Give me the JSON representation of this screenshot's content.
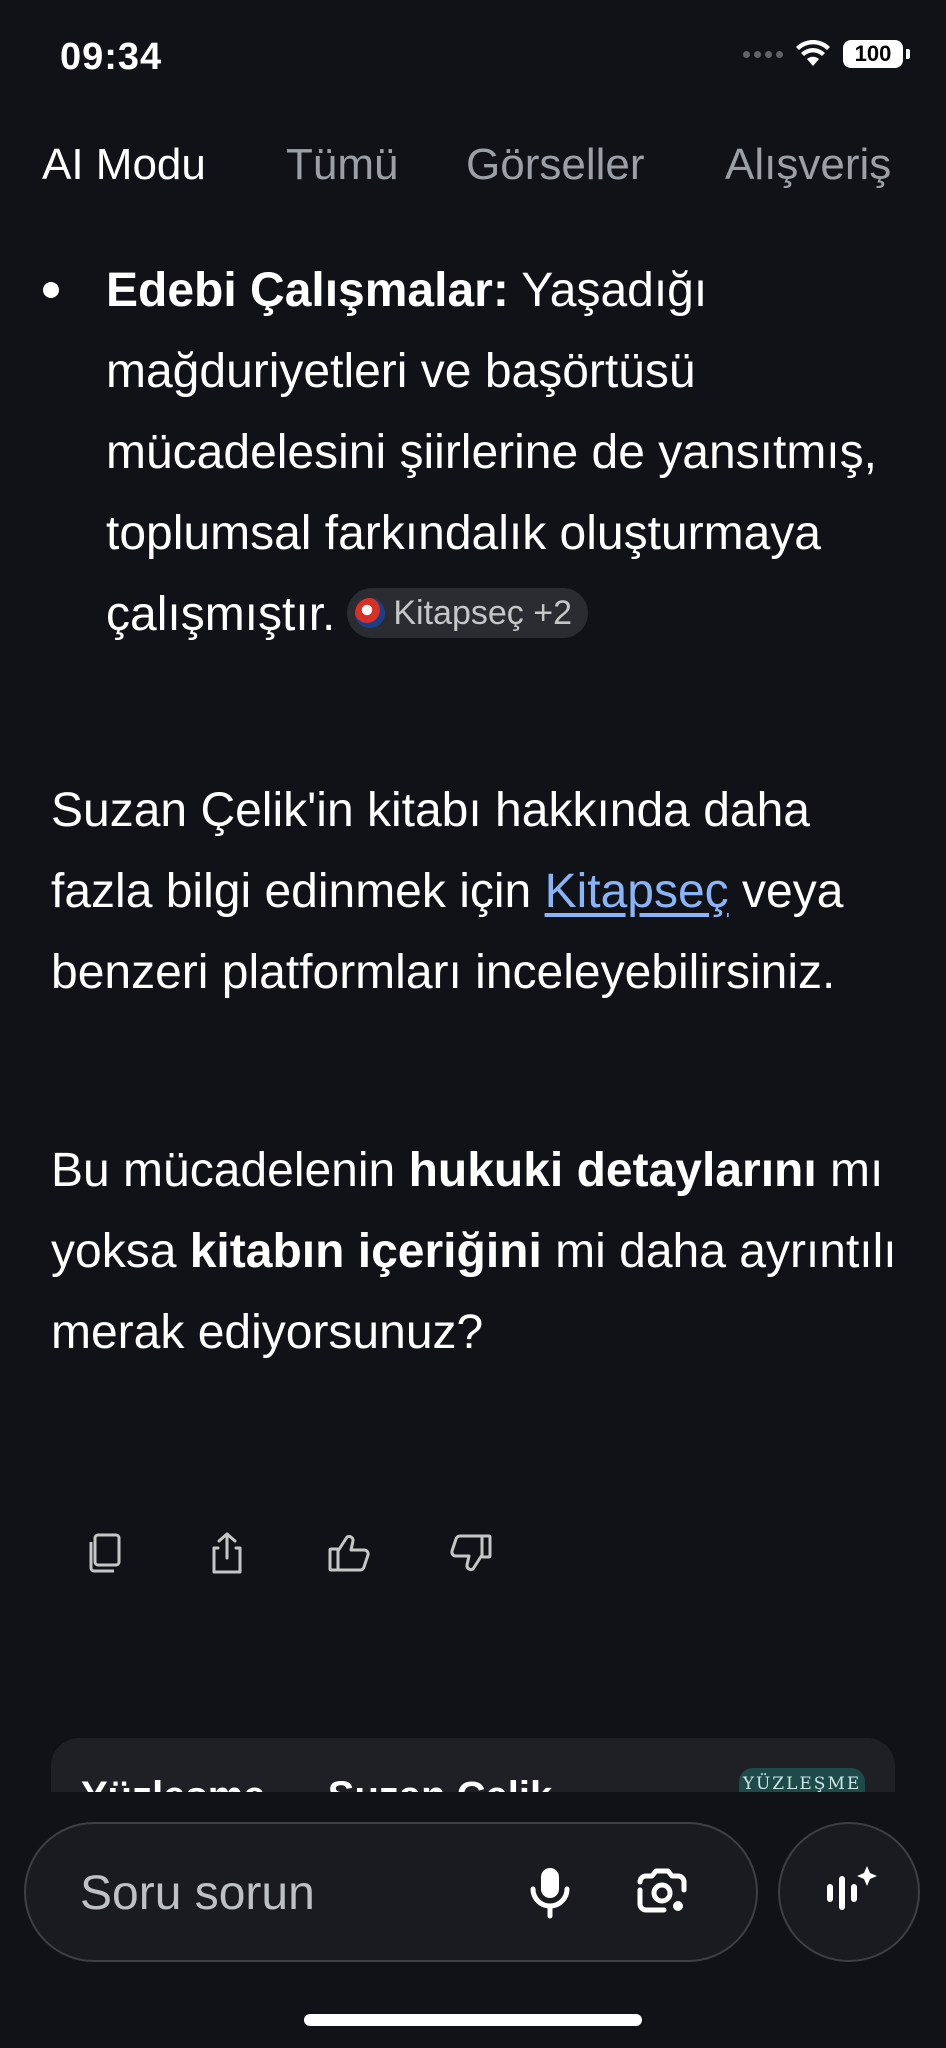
{
  "status_bar": {
    "time": "09:34",
    "battery": "100"
  },
  "tabs": [
    {
      "label": "AI Modu",
      "active": true
    },
    {
      "label": "Tümü",
      "active": false
    },
    {
      "label": "Görseller",
      "active": false
    },
    {
      "label": "Alışveriş",
      "active": false
    }
  ],
  "bullet": {
    "title": "Edebi Çalışmalar:",
    "text": " Yaşadığı mağduriyetleri ve başörtüsü mücadelesini şiirlerine de yansıtmış, toplumsal farkındalık oluşturmaya çalışmıştır.",
    "source_chip": "Kitapseç +2"
  },
  "paragraph1": {
    "before_link": "Suzan Çelik'in kitabı hakkında daha fazla bilgi edinmek için ",
    "link": "Kitapseç",
    "after_link": " veya benzeri platformları inceleyebilirsiniz."
  },
  "paragraph2": {
    "part1": "Bu mücadelenin ",
    "bold1": "hukuki detaylarını",
    "part2": " mı yoksa ",
    "bold2": "kitabın içeriğini",
    "part3": " mi daha ayrıntılı merak ediyorsunuz?"
  },
  "actions": {
    "icons": [
      "copy-icon",
      "share-icon",
      "thumbs-up-icon",
      "thumbs-down-icon"
    ]
  },
  "related_card": {
    "title": "Yüzleşme — Suzan Çelik",
    "thumb_text": "YÜZLEŞME"
  },
  "search": {
    "placeholder": "Soru sorun"
  },
  "colors": {
    "background": "#111217",
    "link": "#8ab4f8",
    "muted": "#9aa0a6"
  }
}
